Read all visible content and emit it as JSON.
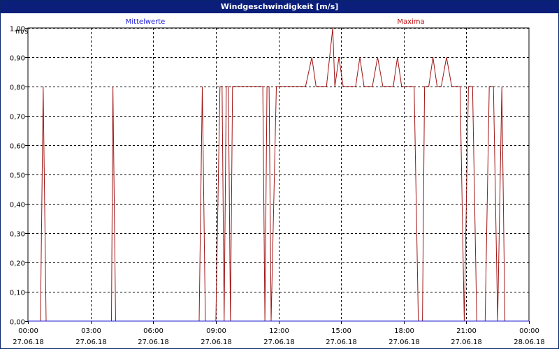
{
  "window": {
    "title": "Windgeschwindigkeit [m/s]"
  },
  "legend": [
    {
      "label": "Mittelwerte",
      "color": "#1a1ad6"
    },
    {
      "label": "Maxima",
      "color": "#c01010"
    }
  ],
  "chart_data": {
    "type": "line",
    "title": "Windgeschwindigkeit [m/s]",
    "ylabel": "m/s",
    "xlabel": "",
    "ylim": [
      0,
      1.0
    ],
    "yticks": [
      "0,00",
      "0,10",
      "0,20",
      "0,30",
      "0,40",
      "0,50",
      "0,60",
      "0,70",
      "0,80",
      "0,90",
      "1,00"
    ],
    "xlim": [
      0,
      24
    ],
    "xticks": [
      {
        "time": "00:00",
        "date": "27.06.18"
      },
      {
        "time": "03:00",
        "date": "27.06.18"
      },
      {
        "time": "06:00",
        "date": "27.06.18"
      },
      {
        "time": "09:00",
        "date": "27.06.18"
      },
      {
        "time": "12:00",
        "date": "27.06.18"
      },
      {
        "time": "15:00",
        "date": "27.06.18"
      },
      {
        "time": "18:00",
        "date": "27.06.18"
      },
      {
        "time": "21:00",
        "date": "27.06.18"
      },
      {
        "time": "00:00",
        "date": "28.06.18"
      }
    ],
    "grid": true,
    "series": [
      {
        "name": "Maxima",
        "color": "#a01414",
        "points": [
          [
            0.0,
            0
          ],
          [
            0.6,
            0
          ],
          [
            0.73,
            0.8
          ],
          [
            0.87,
            0
          ],
          [
            4.0,
            0
          ],
          [
            4.07,
            0.8
          ],
          [
            4.2,
            0
          ],
          [
            8.2,
            0
          ],
          [
            8.35,
            0.8
          ],
          [
            8.5,
            0
          ],
          [
            9.0,
            0
          ],
          [
            9.2,
            0.8
          ],
          [
            9.3,
            0.8
          ],
          [
            9.4,
            0
          ],
          [
            9.5,
            0.8
          ],
          [
            9.6,
            0.8
          ],
          [
            9.7,
            0
          ],
          [
            9.8,
            0.8
          ],
          [
            11.25,
            0.8
          ],
          [
            11.35,
            0
          ],
          [
            11.45,
            0.8
          ],
          [
            11.55,
            0.8
          ],
          [
            11.65,
            0
          ],
          [
            11.9,
            0.8
          ],
          [
            13.3,
            0.8
          ],
          [
            13.6,
            0.9
          ],
          [
            13.8,
            0.8
          ],
          [
            14.3,
            0.8
          ],
          [
            14.6,
            1.0
          ],
          [
            14.7,
            0.8
          ],
          [
            14.9,
            0.9
          ],
          [
            15.1,
            0.8
          ],
          [
            15.7,
            0.8
          ],
          [
            15.9,
            0.9
          ],
          [
            16.1,
            0.8
          ],
          [
            16.5,
            0.8
          ],
          [
            16.75,
            0.9
          ],
          [
            17.0,
            0.8
          ],
          [
            17.5,
            0.8
          ],
          [
            17.7,
            0.9
          ],
          [
            17.9,
            0.8
          ],
          [
            18.5,
            0.8
          ],
          [
            18.7,
            0
          ],
          [
            18.9,
            0
          ],
          [
            19.0,
            0.8
          ],
          [
            19.2,
            0.8
          ],
          [
            19.4,
            0.9
          ],
          [
            19.6,
            0.8
          ],
          [
            19.8,
            0.8
          ],
          [
            20.05,
            0.9
          ],
          [
            20.3,
            0.8
          ],
          [
            20.7,
            0.8
          ],
          [
            20.9,
            0
          ],
          [
            21.1,
            0.8
          ],
          [
            21.3,
            0.8
          ],
          [
            21.5,
            0
          ],
          [
            21.9,
            0
          ],
          [
            22.1,
            0.8
          ],
          [
            22.3,
            0.8
          ],
          [
            22.5,
            0
          ],
          [
            22.7,
            0.8
          ],
          [
            22.85,
            0
          ],
          [
            24.0,
            0
          ]
        ]
      },
      {
        "name": "Mittelwerte",
        "color": "#1a1ad6",
        "points": [
          [
            0.0,
            0
          ],
          [
            24.0,
            0
          ]
        ]
      }
    ]
  }
}
